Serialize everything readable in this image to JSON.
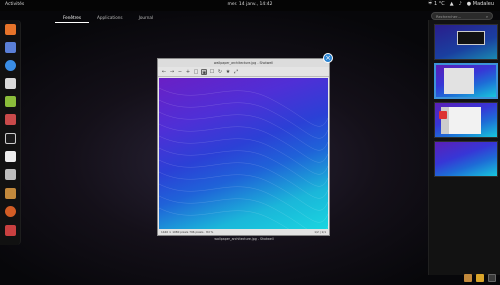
{
  "topbar": {
    "activities": "Activités",
    "clock": "mer. 14 janv., 14:42",
    "temp": "☔ 1 °C",
    "user": "● Madaleu"
  },
  "tabs": [
    {
      "label": "Fenêtres"
    },
    {
      "label": "Applications"
    },
    {
      "label": "Journal"
    }
  ],
  "search": {
    "placeholder": "Rechercher…",
    "icon": "search-icon"
  },
  "window": {
    "title": "wallpaper_architecture.jpg - Shotwell",
    "status_left": "1440 × 1080 pixels  796 pixels · 8d %",
    "status_right": "1/2 | 1/1",
    "caption": "wallpaper_architecture.jpg - Shotwell"
  },
  "dash_items": [
    {
      "icon": "firefox-icon",
      "color": "#e8742a"
    },
    {
      "icon": "mail-icon",
      "color": "#5a7fd6"
    },
    {
      "icon": "chromium-icon",
      "color": "#3a8ee6"
    },
    {
      "icon": "document-icon",
      "color": "#d9d9d9"
    },
    {
      "icon": "install-icon",
      "color": "#8bbd3a"
    },
    {
      "icon": "settings-icon",
      "color": "#c94a4a"
    },
    {
      "icon": "terminal-icon",
      "color": "#1b1b1b"
    },
    {
      "icon": "calendar-icon",
      "color": "#ededed"
    },
    {
      "icon": "calculator-icon",
      "color": "#bdbdbd"
    },
    {
      "icon": "files-icon",
      "color": "#c2893c"
    },
    {
      "icon": "ubuntu-icon",
      "color": "#d35d25"
    },
    {
      "icon": "toolbox-icon",
      "color": "#c94040"
    }
  ],
  "toolbar_icons": [
    "back-icon",
    "forward-icon",
    "zoom-out-icon",
    "zoom-in-icon",
    "zoom-fit-icon",
    "zoom-actual-icon",
    "select-icon",
    "rotate-icon",
    "enhance-icon",
    "fullscreen-icon"
  ],
  "colors": {
    "accent": "#3d93d8",
    "background": "#0b0b0b"
  }
}
